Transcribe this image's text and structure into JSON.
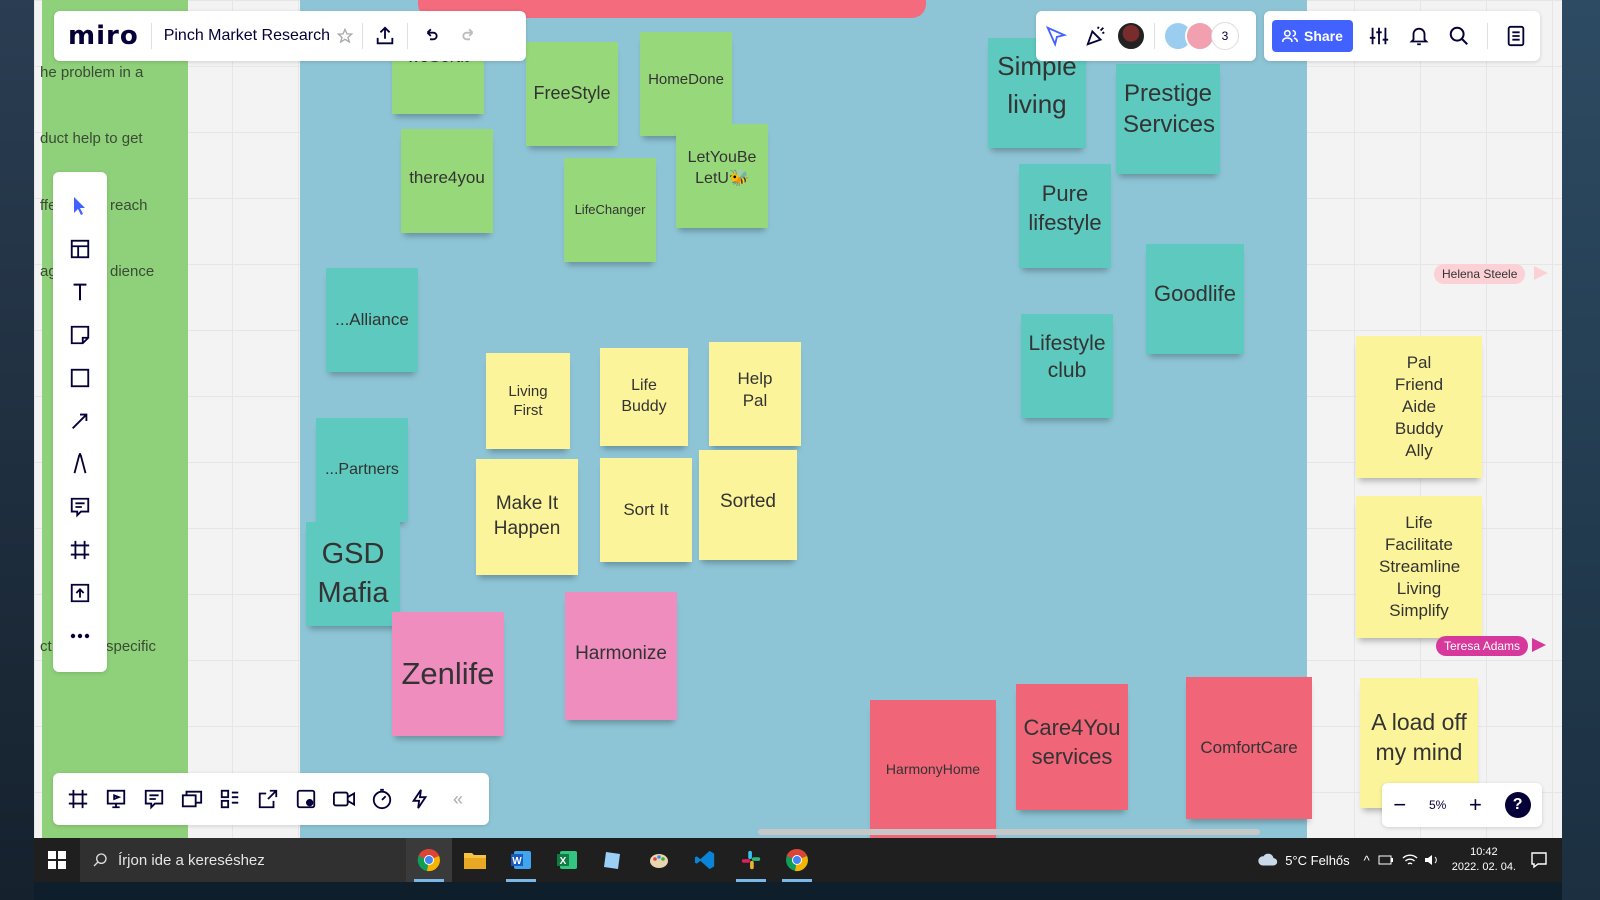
{
  "app": {
    "logo": "miro",
    "board_title": "Pinch Market Research"
  },
  "left_panel_fragments": [
    "he problem in a",
    "duct help to get",
    "ffe",
    "reach",
    "ag",
    "dience",
    "ct",
    "specific"
  ],
  "stickies": {
    "wesortit": "weSortit",
    "freestyle": "FreeStyle",
    "homedone": "HomeDone",
    "there4you": "there4you",
    "lifechanger": "LifeChanger",
    "letyoube": "LetYouBe LetU🐝",
    "alliance": "...Alliance",
    "partners": "...Partners",
    "gsd": "GSD Mafia",
    "zenlife": "Zenlife",
    "harmonize": "Harmonize",
    "living_first": "Living First",
    "life_buddy": "Life Buddy",
    "help_pal": "Help Pal",
    "make_it_happen": "Make It Happen",
    "sort_it": "Sort It",
    "sorted": "Sorted",
    "simple_living": "Simple living",
    "prestige": "Prestige Services",
    "pure_lifestyle": "Pure lifestyle",
    "goodlife": "Goodlife",
    "lifestyle_club": "Lifestyle club",
    "harmonyhome": "HarmonyHome",
    "care4you": "Care4You services",
    "comfortcare": "ComfortCare",
    "pal_list": "Pal Friend Aide Buddy Ally",
    "life_list": "Life Facilitate Streamline Living Simplify",
    "load_off": "A load off my mind"
  },
  "collaborators": {
    "count": "3"
  },
  "actions": {
    "share_label": "Share"
  },
  "cursors": {
    "helena": "Helena Steele",
    "teresa": "Teresa Adams"
  },
  "zoom": {
    "minus": "−",
    "level": "5%",
    "plus": "+",
    "help": "?"
  },
  "taskbar": {
    "search_placeholder": "Írjon ide a kereséshez",
    "weather": "5°C  Felhős",
    "time": "10:42",
    "date": "2022. 02. 04."
  },
  "colors": {
    "accent": "#4262ff",
    "green": "#97d97a",
    "teal": "#5ec9be",
    "yellow": "#fcf49a",
    "pink": "#ee8dbe",
    "red": "#f06577",
    "frame": "#8ec5d6"
  }
}
